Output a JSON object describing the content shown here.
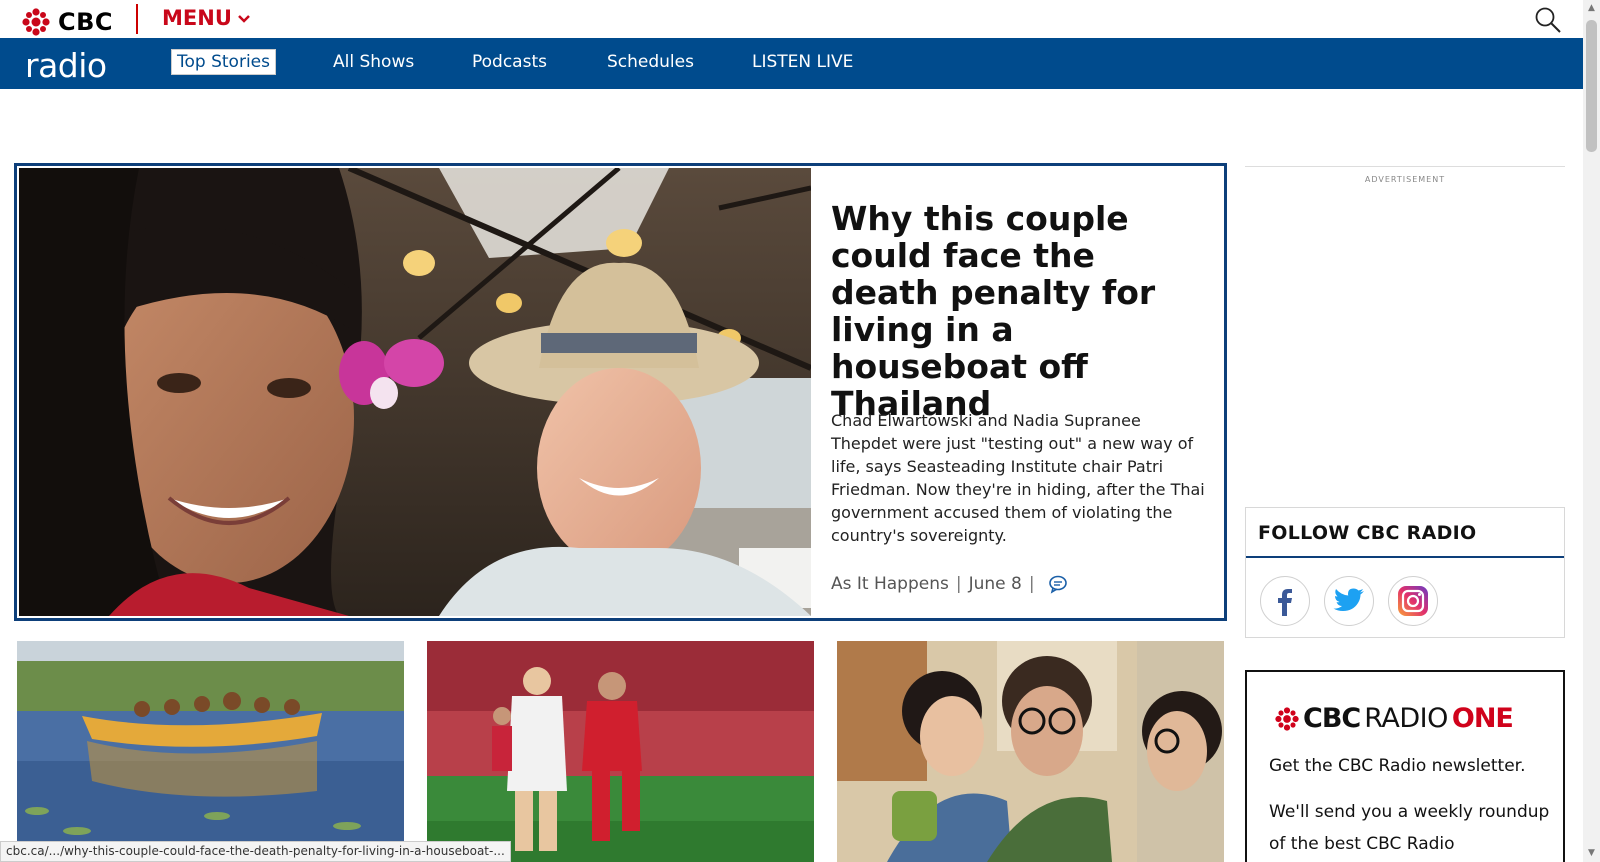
{
  "header": {
    "brand": "CBC",
    "menu_label": "MENU",
    "section_brand": "radio"
  },
  "nav": {
    "items": [
      {
        "label": "Top Stories",
        "active": true
      },
      {
        "label": "All Shows",
        "active": false
      },
      {
        "label": "Podcasts",
        "active": false
      },
      {
        "label": "Schedules",
        "active": false
      },
      {
        "label": "LISTEN LIVE",
        "active": false
      }
    ]
  },
  "hero": {
    "title": "Why this couple could face the death penalty for living in a houseboat off Thailand",
    "summary": "Chad Elwartowski and Nadia Supranee Thepdet were just \"testing out\" a new way of life, says Seasteading Institute chair Patri Friedman. Now they're in hiding, after the Thai government accused them of violating the country's sovereignty.",
    "show": "As It Happens",
    "date": "June 8",
    "separator": "|"
  },
  "sidebar": {
    "ad_label": "ADVERTISEMENT",
    "follow_title": "FOLLOW CBC RADIO",
    "social": [
      "facebook-icon",
      "twitter-icon",
      "instagram-icon"
    ],
    "newsletter": {
      "brand_cbc": "CBC",
      "brand_radio": "RADIO",
      "brand_one": "ONE",
      "line1": "Get the CBC Radio newsletter.",
      "line2": "We'll send you a weekly roundup of the best CBC Radio"
    }
  },
  "status": {
    "url": "cbc.ca/.../why-this-couple-could-face-the-death-penalty-for-living-in-a-houseboat-..."
  },
  "colors": {
    "cbc_red": "#c9071a",
    "nav_blue": "#004b8d",
    "hero_border": "#0d3f7a"
  }
}
